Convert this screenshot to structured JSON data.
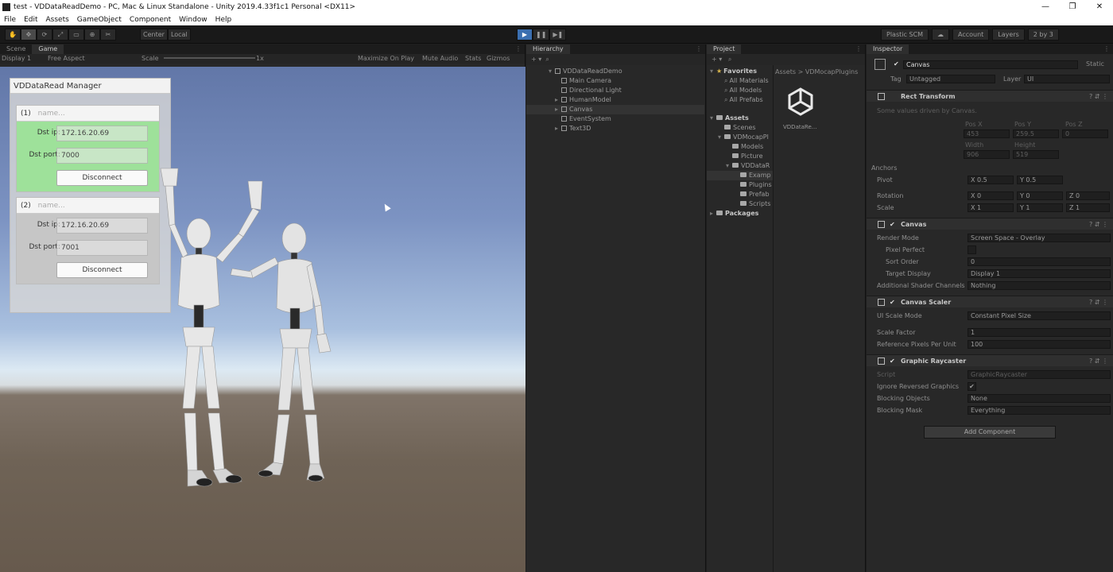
{
  "window": {
    "title": "test - VDDataReadDemo - PC, Mac & Linux Standalone - Unity 2019.4.33f1c1 Personal <DX11>",
    "controls": [
      "—",
      "❐",
      "✕"
    ]
  },
  "menu": [
    "File",
    "Edit",
    "Assets",
    "GameObject",
    "Component",
    "Window",
    "Help"
  ],
  "toolbar": {
    "tools": [
      "✋",
      "✥",
      "⟳",
      "⤢",
      "▭",
      "⊕",
      "✂"
    ],
    "pivot": "Center",
    "space": "Local",
    "play": "▶",
    "pause": "❚❚",
    "step": "▶❚",
    "collab": "Plastic SCM",
    "account": "Account",
    "layers": "Layers",
    "layout": "2 by 3"
  },
  "scene_tabs": [
    "Scene",
    "Game"
  ],
  "game_bar": {
    "display": "Display 1",
    "aspect": "Free Aspect",
    "scale_label": "Scale",
    "scale_value": "1x",
    "maximize": "Maximize On Play",
    "mute": "Mute Audio",
    "stats": "Stats",
    "gizmos": "Gizmos"
  },
  "manager": {
    "title": "VDDataRead Manager",
    "cards": [
      {
        "index": "(1)",
        "name_placeholder": "name...",
        "ip_label": "Dst ip:",
        "ip": "172.16.20.69",
        "port_label": "Dst port:",
        "port": "7000",
        "button": "Disconnect"
      },
      {
        "index": "(2)",
        "name_placeholder": "name...",
        "ip_label": "Dst ip:",
        "ip": "172.16.20.69",
        "port_label": "Dst port:",
        "port": "7001",
        "button": "Disconnect"
      }
    ]
  },
  "hierarchy": {
    "tab": "Hierarchy",
    "items": [
      "VDDataReadDemo",
      "Main Camera",
      "Directional Light",
      "HumanModel",
      "Canvas",
      "EventSystem",
      "Text3D"
    ]
  },
  "project": {
    "tab": "Project",
    "favorites_label": "Favorites",
    "favorites": [
      "All Materials",
      "All Models",
      "All Prefabs"
    ],
    "assets_label": "Assets",
    "tree": [
      "Scenes",
      "VDMocapPl",
      "Models",
      "Picture",
      "VDDataR",
      "Examp",
      "Plugins",
      "Prefab",
      "Scripts"
    ],
    "packages_label": "Packages",
    "breadcrumb": "Assets > VDMocapPlugins",
    "asset_name": "VDDataRe..."
  },
  "inspector": {
    "tab": "Inspector",
    "object": "Canvas",
    "static": "Static",
    "tag_label": "Tag",
    "tag": "Untagged",
    "layer_label": "Layer",
    "layer": "UI",
    "rect": {
      "title": "Rect Transform",
      "note": "Some values driven by Canvas.",
      "headers": [
        "Pos X",
        "Pos Y",
        "Pos Z"
      ],
      "values": [
        "453",
        "259.5",
        "0"
      ],
      "size_headers": [
        "Width",
        "Height"
      ],
      "size_values": [
        "906",
        "519"
      ],
      "anchors": "Anchors",
      "pivot_label": "Pivot",
      "pivot": [
        "X 0.5",
        "Y 0.5"
      ],
      "rotation_label": "Rotation",
      "rotation": [
        "X 0",
        "Y 0",
        "Z 0"
      ],
      "scale_label": "Scale",
      "scale": [
        "X 1",
        "Y 1",
        "Z 1"
      ]
    },
    "canvas": {
      "title": "Canvas",
      "render_mode_label": "Render Mode",
      "render_mode": "Screen Space - Overlay",
      "pixel_perfect_label": "Pixel Perfect",
      "sort_order_label": "Sort Order",
      "sort_order": "0",
      "target_display_label": "Target Display",
      "target_display": "Display 1",
      "shader_label": "Additional Shader Channels",
      "shader": "Nothing"
    },
    "scaler": {
      "title": "Canvas Scaler",
      "mode_label": "UI Scale Mode",
      "mode": "Constant Pixel Size",
      "factor_label": "Scale Factor",
      "factor": "1",
      "ppu_label": "Reference Pixels Per Unit",
      "ppu": "100"
    },
    "raycaster": {
      "title": "Graphic Raycaster",
      "script_label": "Script",
      "script": "GraphicRaycaster",
      "ignore_label": "Ignore Reversed Graphics",
      "ignore": "✔",
      "blocking_label": "Blocking Objects",
      "blocking": "None",
      "mask_label": "Blocking Mask",
      "mask": "Everything"
    },
    "add_component": "Add Component"
  }
}
